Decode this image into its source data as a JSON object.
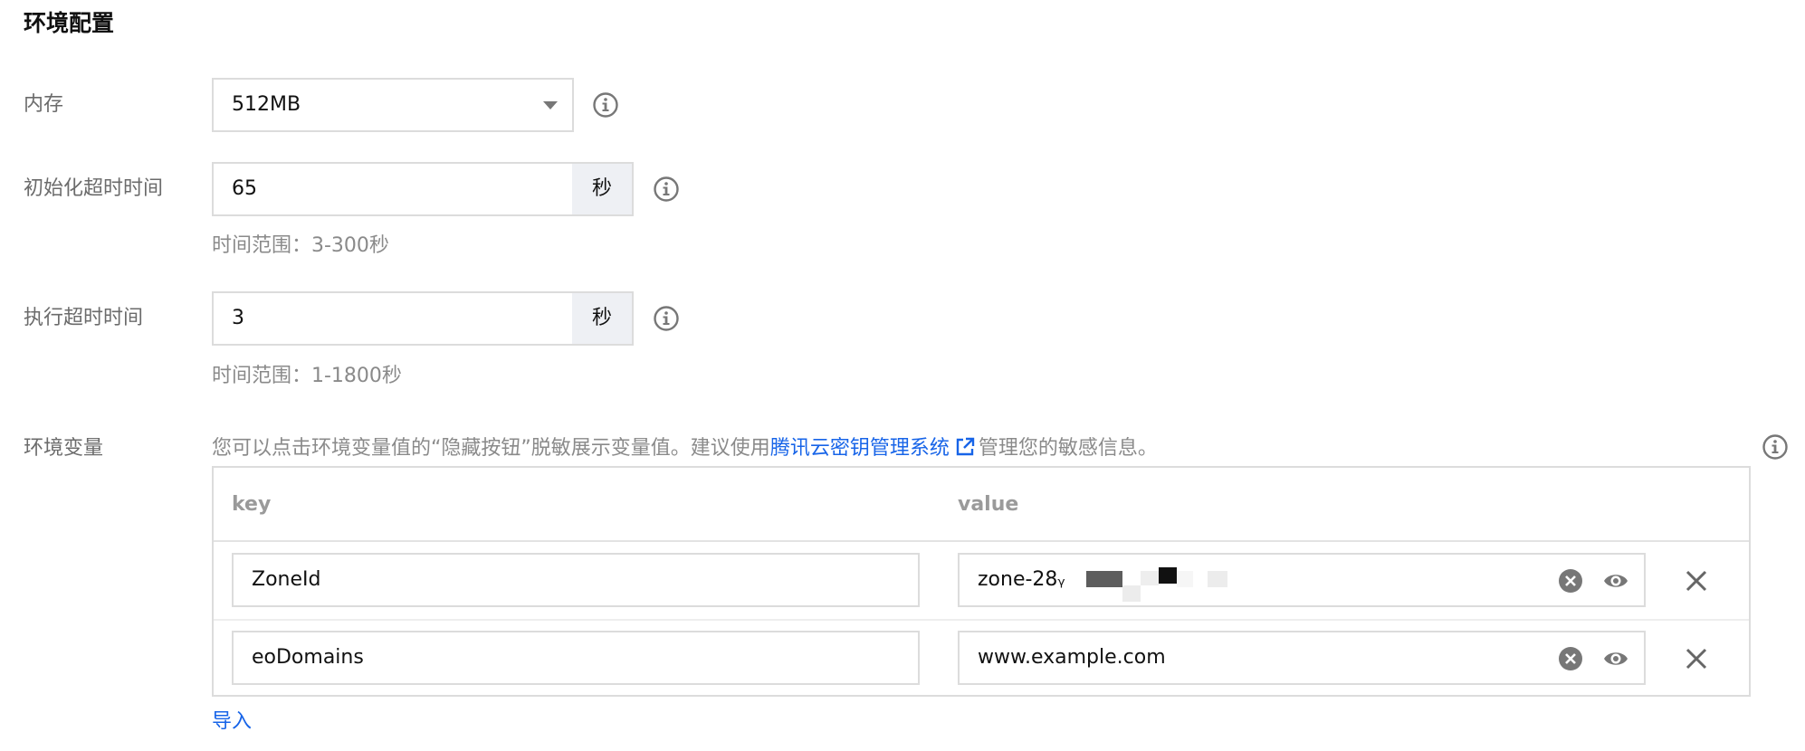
{
  "section": {
    "title": "环境配置"
  },
  "memory": {
    "label": "内存",
    "value": "512MB"
  },
  "init_timeout": {
    "label": "初始化超时时间",
    "value": "65",
    "unit": "秒",
    "hint": "时间范围：3-300秒"
  },
  "exec_timeout": {
    "label": "执行超时时间",
    "value": "3",
    "unit": "秒",
    "hint": "时间范围：1-1800秒"
  },
  "env_vars": {
    "label": "环境变量",
    "hint_prefix": "您可以点击环境变量值的“隐藏按钮”脱敏展示变量值。建议使用",
    "hint_link": "腾讯云密钥管理系统",
    "hint_suffix": "管理您的敏感信息。",
    "col_key": "key",
    "col_value": "value",
    "rows": [
      {
        "key": "ZoneId",
        "value": "zone-28ᵧ"
      },
      {
        "key": "eoDomains",
        "value": "www.example.com"
      }
    ],
    "import_label": "导入"
  },
  "colors": {
    "link": "#1764e8",
    "border": "#dcdcdc",
    "unit_bg": "#eef0f4",
    "label": "#6b6b6b",
    "hint": "#8a8a8a"
  },
  "icons": [
    "info-icon",
    "chevron-down-icon",
    "external-link-icon",
    "clear-icon",
    "eye-icon",
    "close-icon"
  ]
}
